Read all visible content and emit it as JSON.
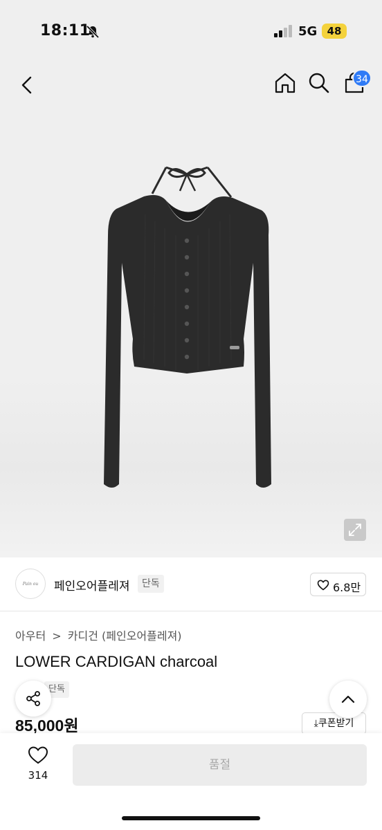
{
  "status_bar": {
    "time": "18:11",
    "network": "5G",
    "battery": "48"
  },
  "header": {
    "cart_count": "34"
  },
  "brand": {
    "logo_text": "Pain ou plaisir",
    "name": "페인오어플레져",
    "tag": "단독",
    "likes": "6.8만"
  },
  "product": {
    "breadcrumb": [
      "아우터",
      ">",
      "카디건 (페인오어플레져)"
    ],
    "title": "LOWER CARDIGAN charcoal",
    "tag": "단독",
    "price": "85,000원",
    "coupon_label": "⤓쿠폰받기"
  },
  "bottom_bar": {
    "wish_count": "314",
    "buy_label": "품절"
  },
  "colors": {
    "accent_badge": "#2f7bf6",
    "battery": "#f4d23c",
    "garment": "#2b2b2b"
  }
}
